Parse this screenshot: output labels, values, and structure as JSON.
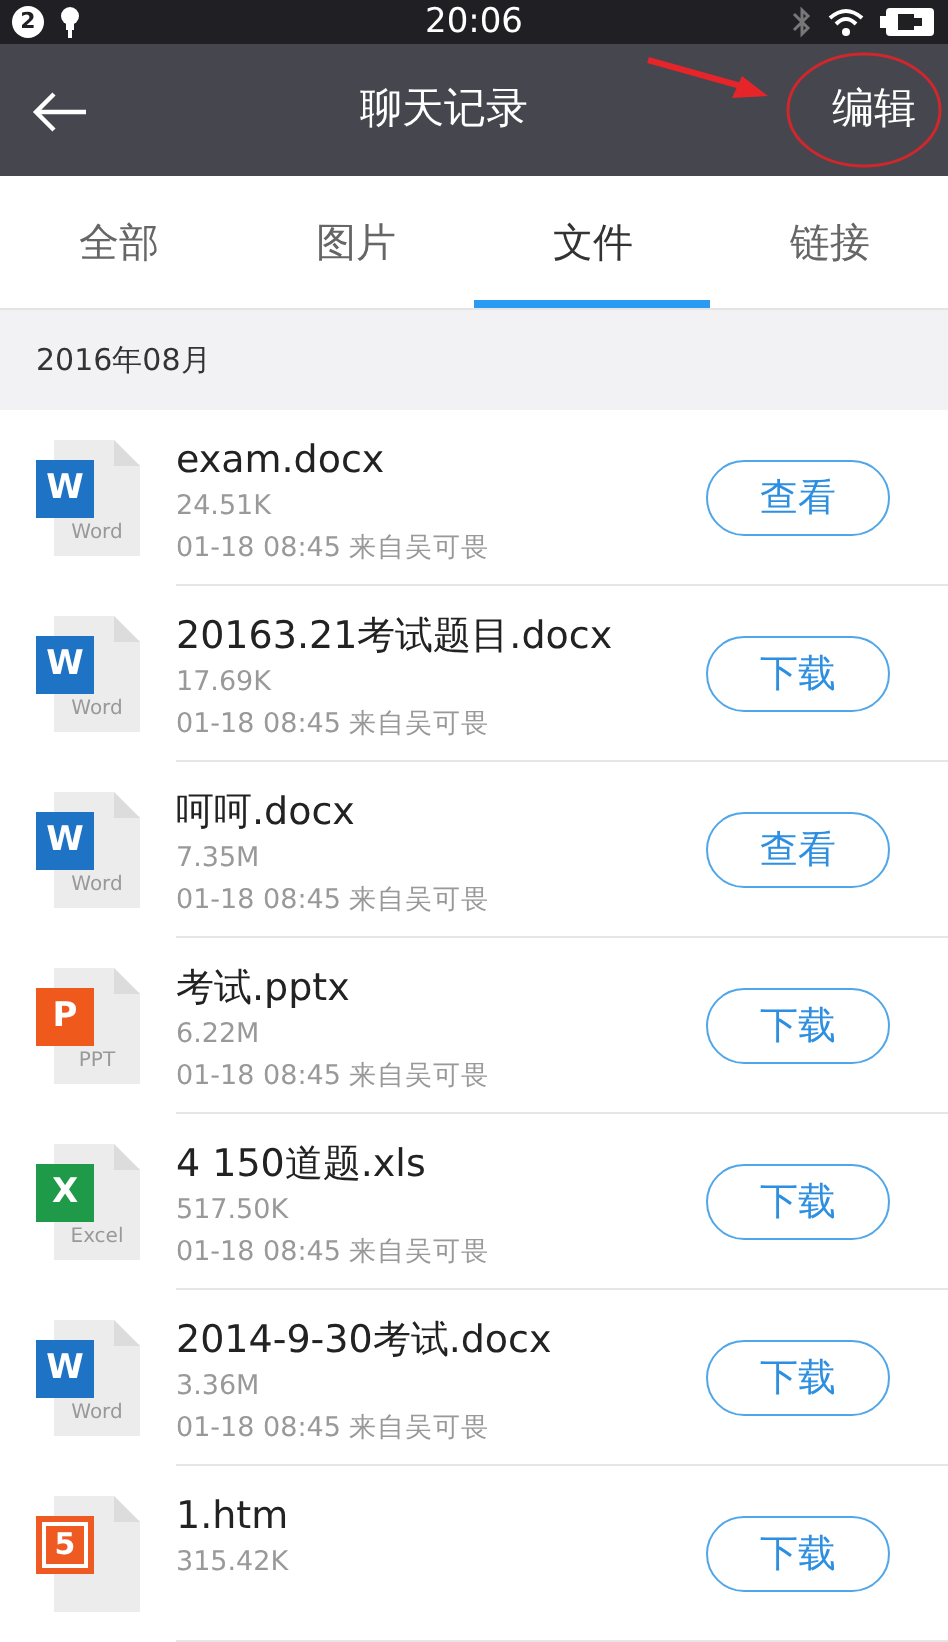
{
  "status_bar": {
    "notification_count": "2",
    "time": "20:06"
  },
  "header": {
    "title": "聊天记录",
    "action": {
      "label": "编辑",
      "circled": true
    }
  },
  "tabs": [
    {
      "label": "全部",
      "selected": false
    },
    {
      "label": "图片",
      "selected": false
    },
    {
      "label": "文件",
      "selected": true
    },
    {
      "label": "链接",
      "selected": false
    }
  ],
  "section": "2016年08月",
  "files": [
    {
      "name": "exam.docx",
      "size": "24.51K",
      "meta": "01-18 08:45 来自吴可畏",
      "icon": {
        "kind": "word",
        "letter": "W",
        "label": "Word"
      },
      "action": "查看"
    },
    {
      "name": "20163.21考试题目.docx",
      "size": "17.69K",
      "meta": "01-18 08:45 来自吴可畏",
      "icon": {
        "kind": "word",
        "letter": "W",
        "label": "Word"
      },
      "action": "下载"
    },
    {
      "name": "呵呵.docx",
      "size": "7.35M",
      "meta": "01-18 08:45 来自吴可畏",
      "icon": {
        "kind": "word",
        "letter": "W",
        "label": "Word"
      },
      "action": "查看"
    },
    {
      "name": "考试.pptx",
      "size": "6.22M",
      "meta": "01-18 08:45 来自吴可畏",
      "icon": {
        "kind": "ppt",
        "letter": "P",
        "label": "PPT"
      },
      "action": "下载"
    },
    {
      "name": "4 150道题.xls",
      "size": "517.50K",
      "meta": "01-18 08:45 来自吴可畏",
      "icon": {
        "kind": "excel",
        "letter": "X",
        "label": "Excel"
      },
      "action": "下载"
    },
    {
      "name": "2014-9-30考试.docx",
      "size": "3.36M",
      "meta": "01-18 08:45 来自吴可畏",
      "icon": {
        "kind": "word",
        "letter": "W",
        "label": "Word"
      },
      "action": "下载"
    },
    {
      "name": "1.htm",
      "size": "315.42K",
      "icon": {
        "kind": "html",
        "letter": "5"
      },
      "action": "下载"
    }
  ]
}
